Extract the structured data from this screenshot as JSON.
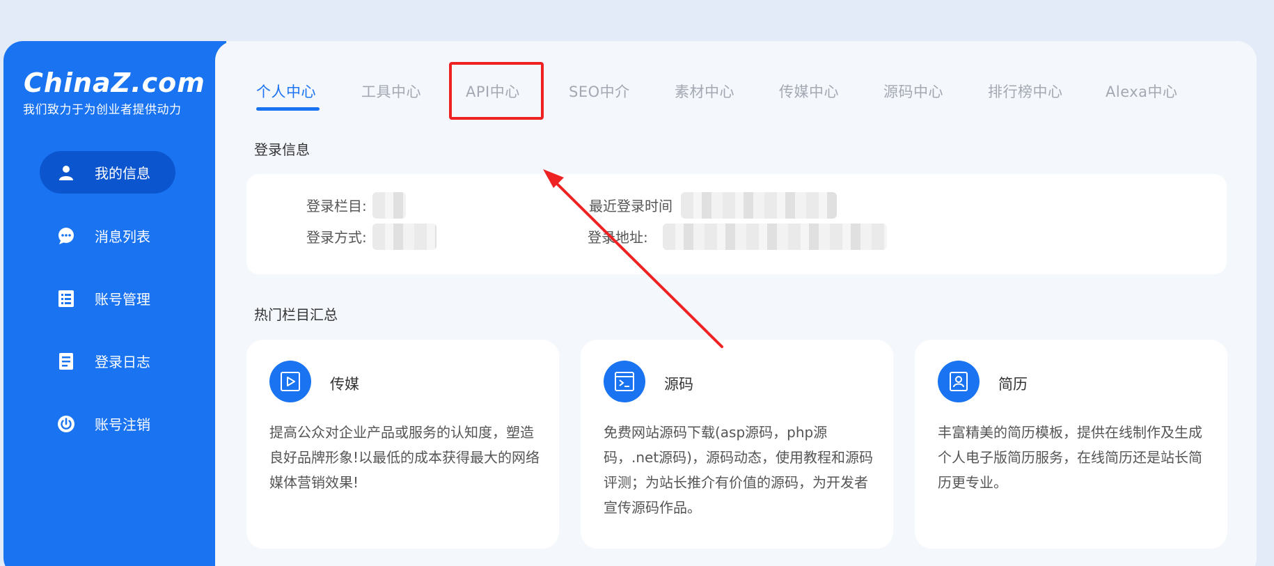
{
  "brand": {
    "logo_text": "ChinaZ.com",
    "slogan": "我们致力于为创业者提供动力"
  },
  "sidebar": {
    "items": [
      {
        "label": "我的信息",
        "icon": "user-icon",
        "active": true
      },
      {
        "label": "消息列表",
        "icon": "chat-bubble-icon",
        "active": false
      },
      {
        "label": "账号管理",
        "icon": "list-icon",
        "active": false
      },
      {
        "label": "登录日志",
        "icon": "log-icon",
        "active": false
      },
      {
        "label": "账号注销",
        "icon": "power-icon",
        "active": false
      }
    ]
  },
  "tabs": [
    {
      "label": "个人中心",
      "active": true
    },
    {
      "label": "工具中心",
      "active": false
    },
    {
      "label": "API中心",
      "active": false,
      "highlighted": true
    },
    {
      "label": "SEO中介",
      "active": false
    },
    {
      "label": "素材中心",
      "active": false
    },
    {
      "label": "传媒中心",
      "active": false
    },
    {
      "label": "源码中心",
      "active": false
    },
    {
      "label": "排行榜中心",
      "active": false
    },
    {
      "label": "Alexa中心",
      "active": false
    }
  ],
  "login_info": {
    "section_title": "登录信息",
    "login_column_label": "登录栏目:",
    "last_login_time_label": "最近登录时间",
    "login_method_label": "登录方式:",
    "login_address_label": "登录地址:"
  },
  "hot_sections": {
    "section_title": "热门栏目汇总",
    "cards": [
      {
        "title": "传媒",
        "icon": "play-icon",
        "description": "提高公众对企业产品或服务的认知度，塑造良好品牌形象!以最低的成本获得最大的网络媒体营销效果!"
      },
      {
        "title": "源码",
        "icon": "terminal-icon",
        "description": "免费网站源码下载(asp源码，php源码，.net源码)，源码动态，使用教程和源码评测；为站长推介有价值的源码，为开发者宣传源码作品。"
      },
      {
        "title": "简历",
        "icon": "profile-card-icon",
        "description": "丰富精美的简历模板，提供在线制作及生成个人电子版简历服务，在线简历还是站长简历更专业。"
      }
    ]
  },
  "colors": {
    "primary": "#1a73f0",
    "sidebar_active": "#0b55cf",
    "annotation_red": "#ee2222",
    "page_bg": "#e3ebf8"
  }
}
